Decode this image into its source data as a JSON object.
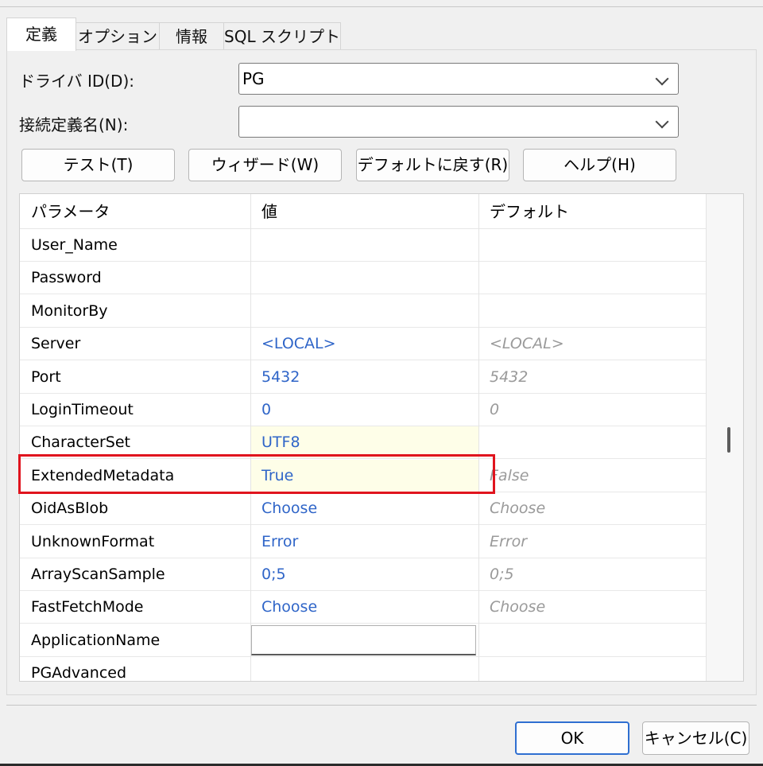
{
  "tabs": [
    {
      "label": "定義"
    },
    {
      "label": "オプション"
    },
    {
      "label": "情報"
    },
    {
      "label": "SQL スクリプト"
    }
  ],
  "form": {
    "driver_label": "ドライバ ID(D):",
    "driver_value": "PG",
    "conn_label": "接続定義名(N):",
    "conn_value": ""
  },
  "buttons": {
    "test": "テスト(T)",
    "wizard": "ウィザード(W)",
    "reset": "デフォルトに戻す(R)",
    "help": "ヘルプ(H)"
  },
  "grid": {
    "headers": [
      "パラメータ",
      "値",
      "デフォルト"
    ],
    "rows": [
      {
        "param": "User_Name",
        "value": "",
        "default": ""
      },
      {
        "param": "Password",
        "value": "",
        "default": ""
      },
      {
        "param": "MonitorBy",
        "value": "",
        "default": ""
      },
      {
        "param": "Server",
        "value": "<LOCAL>",
        "default": "<LOCAL>"
      },
      {
        "param": "Port",
        "value": "5432",
        "default": "5432"
      },
      {
        "param": "LoginTimeout",
        "value": "0",
        "default": "0"
      },
      {
        "param": "CharacterSet",
        "value": "UTF8",
        "default": ""
      },
      {
        "param": "ExtendedMetadata",
        "value": "True",
        "default": "False"
      },
      {
        "param": "OidAsBlob",
        "value": "Choose",
        "default": "Choose"
      },
      {
        "param": "UnknownFormat",
        "value": "Error",
        "default": "Error"
      },
      {
        "param": "ArrayScanSample",
        "value": "0;5",
        "default": "0;5"
      },
      {
        "param": "FastFetchMode",
        "value": "Choose",
        "default": "Choose"
      },
      {
        "param": "ApplicationName",
        "value": "",
        "default": ""
      },
      {
        "param": "PGAdvanced",
        "value": "",
        "default": ""
      }
    ]
  },
  "footer": {
    "ok": "OK",
    "cancel": "キャンセル(C)"
  },
  "colors": {
    "value_text": "#2f65c8",
    "default_text": "#9a9a9a",
    "modified_cell_bg": "#fefee8",
    "highlight_box": "#e0141e",
    "ok_border": "#2f6fd1"
  }
}
